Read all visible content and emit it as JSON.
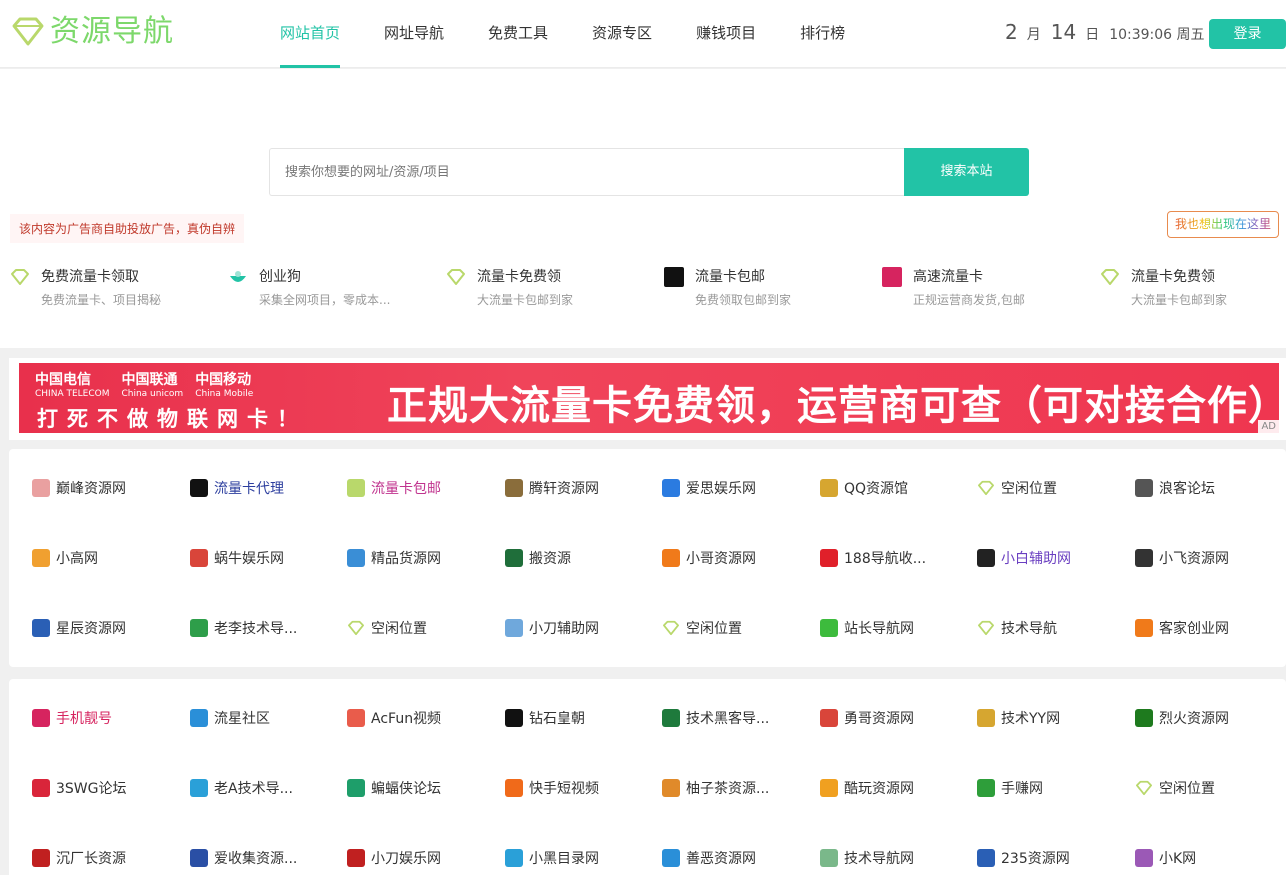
{
  "header": {
    "logo_text": "资源导航",
    "nav": [
      "网站首页",
      "网址导航",
      "免费工具",
      "资源专区",
      "赚钱项目",
      "排行榜"
    ],
    "date": {
      "month": "2",
      "month_unit": "月",
      "day": "14",
      "day_unit": "日",
      "time": "10:39:06 周五"
    },
    "login_label": "登录",
    "accent_color": "#22c3a6"
  },
  "search": {
    "placeholder": "搜索你想要的网址/资源/项目",
    "button_label": "搜索本站"
  },
  "ad_notice": "该内容为广告商自助投放广告，真伪自辨",
  "ad_self_label": "我也想出现在这里",
  "features": [
    {
      "title": "免费流量卡领取",
      "desc": "免费流量卡、项目揭秘",
      "icon": "diamond-icon"
    },
    {
      "title": "创业狗",
      "desc": "采集全网项目，零成本...",
      "icon": "bowl-icon"
    },
    {
      "title": "流量卡免费领",
      "desc": "大流量卡包邮到家",
      "icon": "diamond-icon"
    },
    {
      "title": "流量卡包邮",
      "desc": "免费领取包邮到家",
      "icon": "card-logo-icon"
    },
    {
      "title": "高速流量卡",
      "desc": "正规运营商发货,包邮",
      "icon": "lianghao-icon"
    },
    {
      "title": "流量卡免费领",
      "desc": "大流量卡包邮到家",
      "icon": "diamond-icon"
    }
  ],
  "banner": {
    "operators": [
      {
        "cn": "中国电信",
        "en": "CHINA TELECOM"
      },
      {
        "cn": "中国联通",
        "en": "China unicom"
      },
      {
        "cn": "中国移动",
        "en": "China Mobile"
      }
    ],
    "slogan": "打死不做物联网卡！",
    "main": "正规大流量卡免费领，运营商可查（可对接合作）",
    "ad_tag": "AD"
  },
  "links_panel1": [
    {
      "label": "巅峰资源网",
      "color": "#333333",
      "icon_color": "#e9a0a0"
    },
    {
      "label": "流量卡代理",
      "color": "#2c3e9e",
      "icon_color": "#111111"
    },
    {
      "label": "流量卡包邮",
      "color": "#c0338e",
      "icon_color": "#b9d86b"
    },
    {
      "label": "腾轩资源网",
      "color": "#333333",
      "icon_color": "#8a6d3b"
    },
    {
      "label": "爱思娱乐网",
      "color": "#333333",
      "icon_color": "#2b7be0"
    },
    {
      "label": "QQ资源馆",
      "color": "#333333",
      "icon_color": "#d6a630"
    },
    {
      "label": "空闲位置",
      "color": "#333333",
      "icon_color": "#b9d86b"
    },
    {
      "label": "浪客论坛",
      "color": "#333333",
      "icon_color": "#555555"
    },
    {
      "label": "小高网",
      "color": "#333333",
      "icon_color": "#f0a030"
    },
    {
      "label": "蜗牛娱乐网",
      "color": "#333333",
      "icon_color": "#d9453a"
    },
    {
      "label": "精品货源网",
      "color": "#333333",
      "icon_color": "#3a8ed6"
    },
    {
      "label": "搬资源",
      "color": "#333333",
      "icon_color": "#1f6e3a"
    },
    {
      "label": "小哥资源网",
      "color": "#333333",
      "icon_color": "#f07a1a"
    },
    {
      "label": "188导航收...",
      "color": "#333333",
      "icon_color": "#e0202a"
    },
    {
      "label": "小白辅助网",
      "color": "#6a3fc1",
      "icon_color": "#222222"
    },
    {
      "label": "小飞资源网",
      "color": "#333333",
      "icon_color": "#333333"
    },
    {
      "label": "星辰资源网",
      "color": "#333333",
      "icon_color": "#2a5fb5"
    },
    {
      "label": "老李技术导...",
      "color": "#333333",
      "icon_color": "#2e9e4a"
    },
    {
      "label": "空闲位置",
      "color": "#333333",
      "icon_color": "#b9d86b"
    },
    {
      "label": "小刀辅助网",
      "color": "#333333",
      "icon_color": "#6fa8dc"
    },
    {
      "label": "空闲位置",
      "color": "#333333",
      "icon_color": "#b9d86b"
    },
    {
      "label": "站长导航网",
      "color": "#333333",
      "icon_color": "#3dbb3d"
    },
    {
      "label": "技术导航",
      "color": "#333333",
      "icon_color": "#b9d86b"
    },
    {
      "label": "客家创业网",
      "color": "#333333",
      "icon_color": "#f07a1a"
    }
  ],
  "links_panel2": [
    {
      "label": "手机靓号",
      "color": "#d6245f",
      "icon_color": "#d6245f"
    },
    {
      "label": "流星社区",
      "color": "#333333",
      "icon_color": "#2a8fd8"
    },
    {
      "label": "AcFun视频",
      "color": "#333333",
      "icon_color": "#e95c4b"
    },
    {
      "label": "钻石皇朝",
      "color": "#333333",
      "icon_color": "#111111"
    },
    {
      "label": "技术黑客导...",
      "color": "#333333",
      "icon_color": "#1e7a3c"
    },
    {
      "label": "勇哥资源网",
      "color": "#333333",
      "icon_color": "#d9453a"
    },
    {
      "label": "技术YY网",
      "color": "#333333",
      "icon_color": "#d6a630"
    },
    {
      "label": "烈火资源网",
      "color": "#333333",
      "icon_color": "#1e7a1e"
    },
    {
      "label": "3SWG论坛",
      "color": "#333333",
      "icon_color": "#d9253a"
    },
    {
      "label": "老A技术导...",
      "color": "#333333",
      "icon_color": "#2aa0d8"
    },
    {
      "label": "蝙蝠侠论坛",
      "color": "#333333",
      "icon_color": "#1e9e6a"
    },
    {
      "label": "快手短视频",
      "color": "#333333",
      "icon_color": "#f06a1a"
    },
    {
      "label": "柚子茶资源...",
      "color": "#333333",
      "icon_color": "#e08a2a"
    },
    {
      "label": "酷玩资源网",
      "color": "#333333",
      "icon_color": "#f0a020"
    },
    {
      "label": "手赚网",
      "color": "#333333",
      "icon_color": "#2e9e3a"
    },
    {
      "label": "空闲位置",
      "color": "#333333",
      "icon_color": "#b9d86b"
    },
    {
      "label": "沉厂长资源",
      "color": "#333333",
      "icon_color": "#c02020"
    },
    {
      "label": "爱收集资源...",
      "color": "#333333",
      "icon_color": "#2a4fa5"
    },
    {
      "label": "小刀娱乐网",
      "color": "#333333",
      "icon_color": "#c02020"
    },
    {
      "label": "小黑目录网",
      "color": "#333333",
      "icon_color": "#2aa0d8"
    },
    {
      "label": "善恶资源网",
      "color": "#333333",
      "icon_color": "#2a8fd8"
    },
    {
      "label": "技术导航网",
      "color": "#333333",
      "icon_color": "#7ab88a"
    },
    {
      "label": "235资源网",
      "color": "#333333",
      "icon_color": "#2a5fb5"
    },
    {
      "label": "小K网",
      "color": "#333333",
      "icon_color": "#9b59b6"
    }
  ]
}
